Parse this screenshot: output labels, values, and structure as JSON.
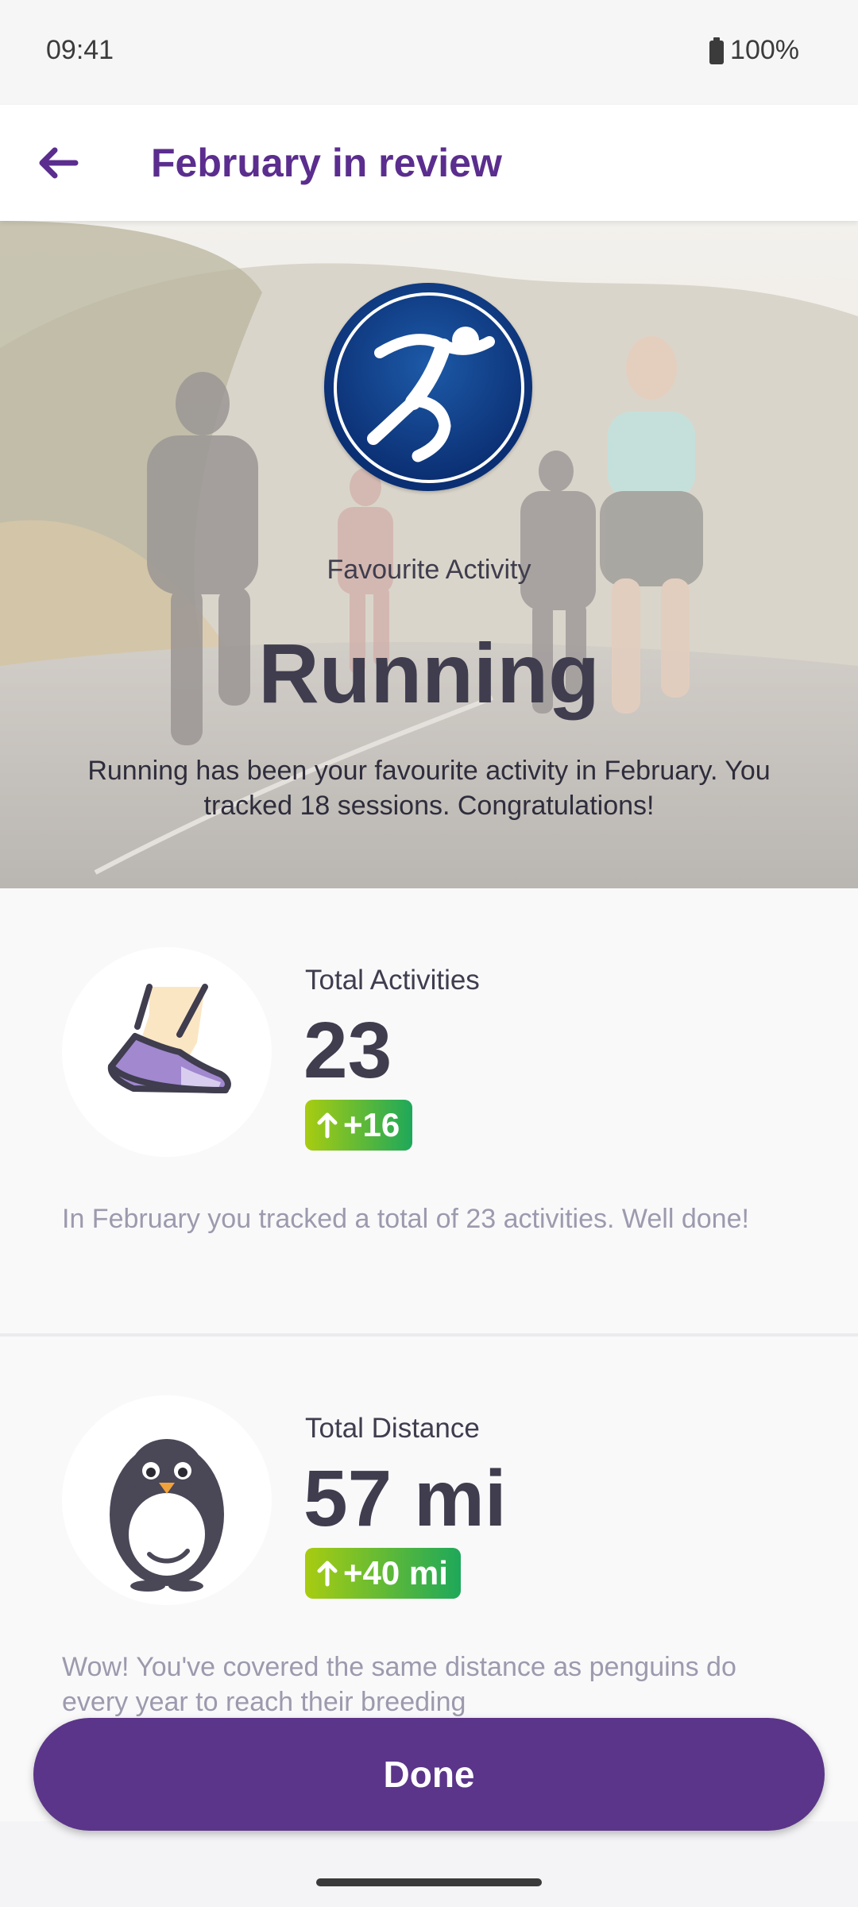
{
  "status_bar": {
    "time": "09:41",
    "battery": "100%"
  },
  "header": {
    "title": "February in review"
  },
  "favourite": {
    "label": "Favourite Activity",
    "activity": "Running",
    "description": "Running has been your favourite activity in February. You tracked 18 sessions. Congratulations!"
  },
  "stats": [
    {
      "label": "Total Activities",
      "value": "23",
      "delta": "+16",
      "icon": "running-shoe-icon",
      "description": "In February you tracked a total of 23 activities. Well done!"
    },
    {
      "label": "Total Distance",
      "value": "57 mi",
      "delta": "+40 mi",
      "icon": "penguin-icon",
      "description": "Wow! You've covered the same distance as penguins do every year to reach their breeding"
    }
  ],
  "footer": {
    "done_label": "Done"
  },
  "colors": {
    "brand_purple": "#5b2d8e",
    "button_purple": "#5b3589",
    "delta_gradient_start": "#a8cc11",
    "delta_gradient_end": "#1ea85a",
    "badge_blue": "#0b3f86"
  }
}
